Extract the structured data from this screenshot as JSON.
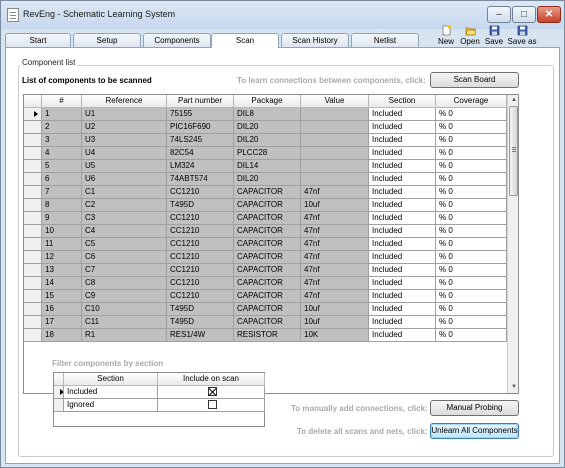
{
  "window": {
    "title": "RevEng - Schematic Learning System"
  },
  "tabs": [
    {
      "label": "Start"
    },
    {
      "label": "Setup"
    },
    {
      "label": "Components"
    },
    {
      "label": "Scan"
    },
    {
      "label": "Scan History"
    },
    {
      "label": "Netlist"
    }
  ],
  "active_tab": "Scan",
  "toolbar": {
    "new_label": "New",
    "open_label": "Open",
    "save_label": "Save",
    "saveas_label": "Save as"
  },
  "component_list": {
    "group_title": "Component list",
    "heading": "List of components to be scanned",
    "learn_hint": "To learn connections between components, click:",
    "scan_board_label": "Scan Board",
    "columns": [
      "#",
      "Reference",
      "Part number",
      "Package",
      "Value",
      "Section",
      "Coverage"
    ],
    "rows": [
      [
        "1",
        "U1",
        "75155",
        "DIL8",
        "",
        "Included",
        "% 0"
      ],
      [
        "2",
        "U2",
        "PIC16F690",
        "DIL20",
        "",
        "Included",
        "% 0"
      ],
      [
        "3",
        "U3",
        "74LS245",
        "DIL20",
        "",
        "Included",
        "% 0"
      ],
      [
        "4",
        "U4",
        "82C54",
        "PLCC28",
        "",
        "Included",
        "% 0"
      ],
      [
        "5",
        "U5",
        "LM324",
        "DIL14",
        "",
        "Included",
        "% 0"
      ],
      [
        "6",
        "U6",
        "74ABT574",
        "DIL20",
        "",
        "Included",
        "% 0"
      ],
      [
        "7",
        "C1",
        "CC1210",
        "CAPACITOR",
        "47nf",
        "Included",
        "% 0"
      ],
      [
        "8",
        "C2",
        "T495D",
        "CAPACITOR",
        "10uf",
        "Included",
        "% 0"
      ],
      [
        "9",
        "C3",
        "CC1210",
        "CAPACITOR",
        "47nf",
        "Included",
        "% 0"
      ],
      [
        "10",
        "C4",
        "CC1210",
        "CAPACITOR",
        "47nf",
        "Included",
        "% 0"
      ],
      [
        "11",
        "C5",
        "CC1210",
        "CAPACITOR",
        "47nf",
        "Included",
        "% 0"
      ],
      [
        "12",
        "C6",
        "CC1210",
        "CAPACITOR",
        "47nf",
        "Included",
        "% 0"
      ],
      [
        "13",
        "C7",
        "CC1210",
        "CAPACITOR",
        "47nf",
        "Included",
        "% 0"
      ],
      [
        "14",
        "C8",
        "CC1210",
        "CAPACITOR",
        "47nf",
        "Included",
        "% 0"
      ],
      [
        "15",
        "C9",
        "CC1210",
        "CAPACITOR",
        "47nf",
        "Included",
        "% 0"
      ],
      [
        "16",
        "C10",
        "T495D",
        "CAPACITOR",
        "10uf",
        "Included",
        "% 0"
      ],
      [
        "17",
        "C11",
        "T495D",
        "CAPACITOR",
        "10uf",
        "Included",
        "% 0"
      ],
      [
        "18",
        "R1",
        "RES1/4W",
        "RESISTOR",
        "10K",
        "Included",
        "% 0"
      ]
    ]
  },
  "filter": {
    "title": "Filter components by section",
    "columns": [
      "Section",
      "Include on scan"
    ],
    "rows": [
      {
        "section": "Included",
        "checked": true
      },
      {
        "section": "Ignored",
        "checked": false
      }
    ]
  },
  "actions": {
    "manual_hint": "To manually add connections, click:",
    "manual_label": "Manual Probing",
    "unlearn_hint": "To delete all scans and nets, click:",
    "unlearn_label": "Unlearn All Components"
  },
  "colors": {
    "readonly_cell": "#c0c0c0",
    "hint_text": "#a9a9a9",
    "accent": "#3c7fb1"
  }
}
